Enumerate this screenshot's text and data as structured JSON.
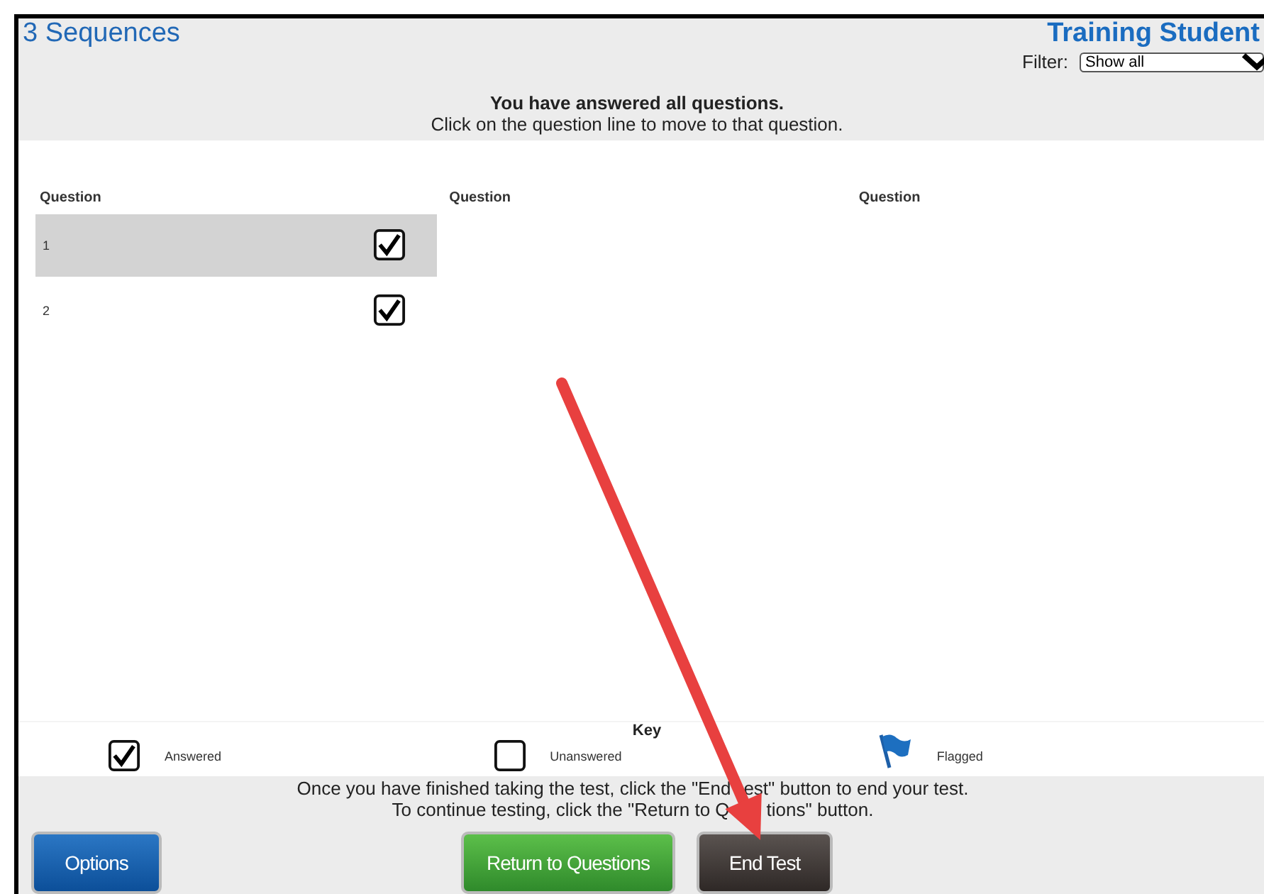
{
  "title": "3 Sequences",
  "user": "Training Student",
  "filter": {
    "label": "Filter:",
    "value": "Show all"
  },
  "message": {
    "heading": "You have answered all questions.",
    "instruction": "Click on the question line to move to that question."
  },
  "columns": [
    {
      "header": "Question",
      "questions": [
        {
          "number": "1",
          "answered": true,
          "selected": true
        },
        {
          "number": "2",
          "answered": true,
          "selected": false
        }
      ]
    },
    {
      "header": "Question"
    },
    {
      "header": "Question"
    }
  ],
  "key": {
    "title": "Key",
    "items": [
      {
        "kind": "answered",
        "label": "Answered"
      },
      {
        "kind": "unanswered",
        "label": "Unanswered"
      },
      {
        "kind": "flagged",
        "label": "Flagged"
      }
    ]
  },
  "footer_lines": [
    {
      "parts": [
        "Once you have finished taking the test, click the \"End",
        "est\" button to end your test."
      ]
    },
    {
      "parts": [
        "To continue testing, click the \"Return to Q",
        "tions\" button."
      ]
    }
  ],
  "buttons": [
    {
      "label": "Options",
      "kind": "options"
    },
    {
      "label": "Return to Questions",
      "kind": "return"
    },
    {
      "label": "End Test",
      "kind": "end"
    }
  ]
}
